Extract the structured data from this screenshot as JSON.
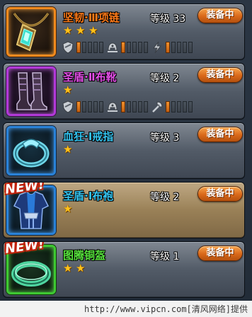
{
  "equip_label": "装备中",
  "items": [
    {
      "name": "坚韧·Ⅲ项链",
      "level_label": "等级 33",
      "stars": 3,
      "new": false,
      "rarity": "orange",
      "icon": "amulet-icon",
      "stats": [
        {
          "icon": "shield-icon",
          "filled": 1,
          "total": 5
        },
        {
          "icon": "helmet-icon",
          "filled": 1,
          "total": 5
        },
        {
          "icon": "lightning-icon",
          "filled": 1,
          "total": 5
        }
      ]
    },
    {
      "name": "圣盾·Ⅱ布靴",
      "level_label": "等级 2",
      "stars": 1,
      "new": false,
      "rarity": "purple",
      "icon": "boots-icon",
      "stats": [
        {
          "icon": "shield-icon",
          "filled": 1,
          "total": 5
        },
        {
          "icon": "helmet-icon",
          "filled": 1,
          "total": 5
        },
        {
          "icon": "axe-icon",
          "filled": 1,
          "total": 5
        }
      ]
    },
    {
      "name": "血狂·Ⅰ戒指",
      "level_label": "等级 3",
      "stars": 1,
      "new": false,
      "rarity": "blue",
      "icon": "ring-icon",
      "stats": []
    },
    {
      "name": "圣盾·Ⅰ布袍",
      "level_label": "等级 2",
      "stars": 1,
      "new": true,
      "rarity": "blue",
      "icon": "robe-icon",
      "stats": []
    },
    {
      "name": "图腾铜盔",
      "level_label": "等级 1",
      "stars": 2,
      "new": true,
      "rarity": "green",
      "icon": "bracelet-icon",
      "stats": []
    }
  ],
  "new_label": "NEW!",
  "watermark": "http://www.vipcn.com[清风网络]提供",
  "colors": {
    "orange": "#f08a1e",
    "purple": "#b23ad8",
    "blue": "#2a82d8",
    "green": "#3ec832",
    "bar_fill": "#f2912d",
    "star": "#ffc21a"
  }
}
